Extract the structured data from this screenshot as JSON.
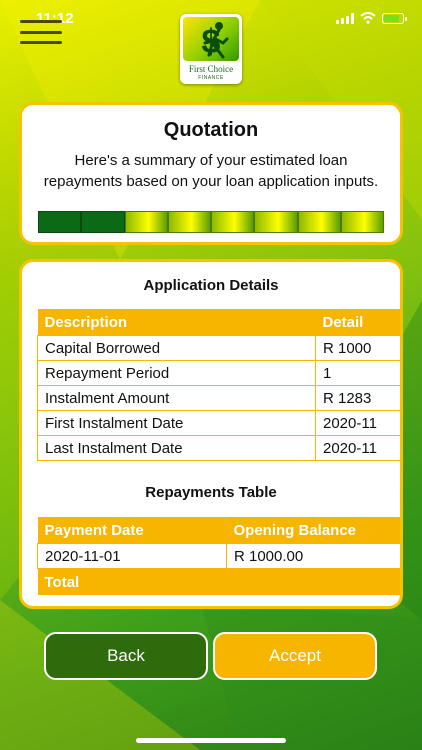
{
  "status": {
    "time": "11:12"
  },
  "header": {
    "logo_text": "First Choice",
    "logo_subtext": "FINANCE",
    "menu_icon": "hamburger-icon",
    "logo_icon": "dollar-runner-logo"
  },
  "quotation": {
    "title": "Quotation",
    "summary": "Here's a summary of your estimated loan repayments based on your loan application inputs.",
    "progress": {
      "total_steps": 8,
      "completed_steps": 2
    }
  },
  "application_details": {
    "title": "Application Details",
    "columns": [
      "Description",
      "Detail"
    ],
    "rows": [
      [
        "Capital Borrowed",
        "R 1000"
      ],
      [
        "Repayment Period",
        "1"
      ],
      [
        "Instalment Amount",
        "R 1283"
      ],
      [
        "First Instalment Date",
        "2020-11"
      ],
      [
        "Last Instalment Date",
        "2020-11"
      ]
    ]
  },
  "repayments": {
    "title": "Repayments Table",
    "columns": [
      "Payment Date",
      "Opening Balance"
    ],
    "rows": [
      [
        "2020-11-01",
        "R 1000.00"
      ]
    ],
    "total_label": "Total"
  },
  "buttons": {
    "back": "Back",
    "accept": "Accept"
  },
  "colors": {
    "accent": "#f7b500",
    "dark_green": "#2e6b0c",
    "progress_done": "#0a6a16"
  }
}
